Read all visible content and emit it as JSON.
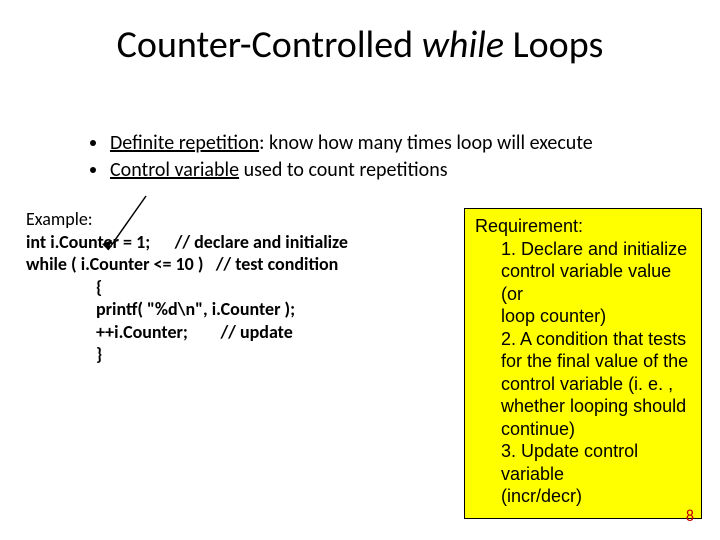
{
  "title": {
    "pre": "Counter-Controlled ",
    "italic": "while",
    "post": " Loops"
  },
  "bullets": {
    "b1_pre": "Definite repetition",
    "b1_post": ": know how many times loop will execute",
    "b2_pre": "Control variable",
    "b2_post": " used to count repetitions"
  },
  "example": {
    "heading": "Example:",
    "line1_a": "int i.Counter = 1;",
    "line1_b": "// declare and initialize",
    "line2_a": "while ( i.Counter <= 10 )",
    "line2_b": "// test condition",
    "line3": "{",
    "line4": "printf( \"%d\\n\", i.Counter );",
    "line5_a": "++i.Counter;",
    "line5_b": "// update",
    "line6": "}"
  },
  "requirement": {
    "heading": "Requirement:",
    "r1a": "1. Declare and initialize",
    "r1b": "control variable value (or",
    "r1c": "loop counter)",
    "r2a": "2. A condition that tests",
    "r2b": "for the final value of the",
    "r2c": "control variable (i. e. ,",
    "r2d": "whether looping should",
    "r2e": "continue)",
    "r3a": "3. Update control variable",
    "r3b": "(incr/decr)"
  },
  "page_number": "8"
}
